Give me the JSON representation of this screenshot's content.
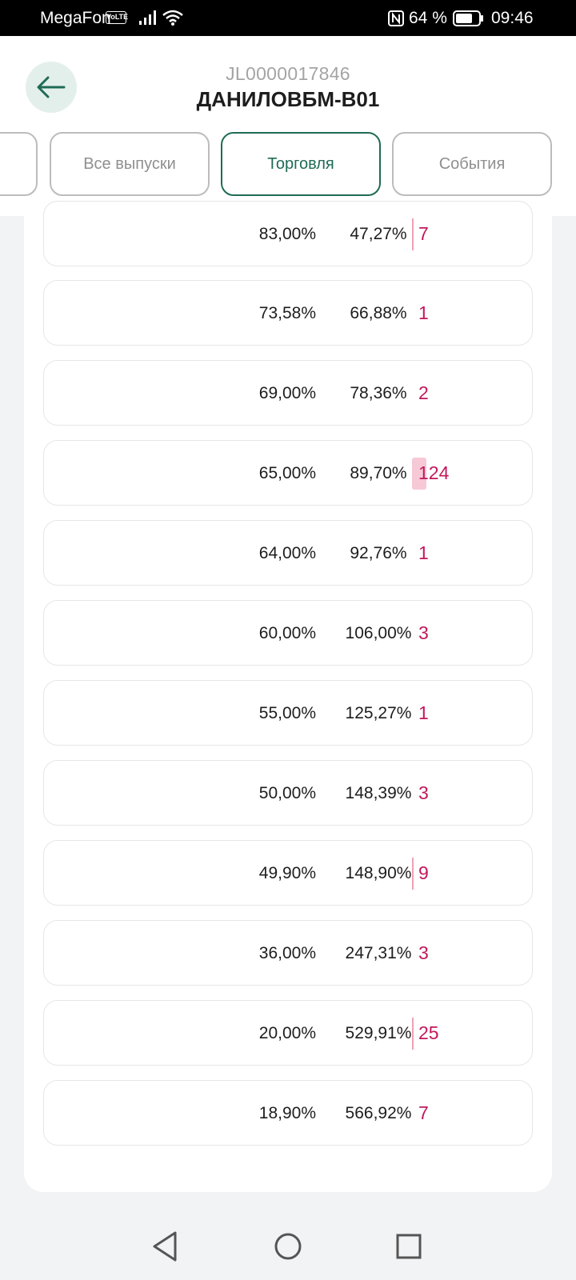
{
  "status_bar": {
    "carrier": "MegaFon",
    "volte": "VoLTE",
    "battery_percent": "64 %",
    "time": "09:46"
  },
  "header": {
    "subtitle": "JL0000017846",
    "title": "ДАНИЛОВБМ-В01"
  },
  "tabs": [
    {
      "label": "",
      "active": false
    },
    {
      "label": "Все выпуски",
      "active": false
    },
    {
      "label": "Торговля",
      "active": true
    },
    {
      "label": "События",
      "active": false
    }
  ],
  "rows": [
    {
      "price": "83,00%",
      "yield": "47,27%",
      "qty": "7"
    },
    {
      "price": "73,58%",
      "yield": "66,88%",
      "qty": "1"
    },
    {
      "price": "69,00%",
      "yield": "78,36%",
      "qty": "2"
    },
    {
      "price": "65,00%",
      "yield": "89,70%",
      "qty": "124"
    },
    {
      "price": "64,00%",
      "yield": "92,76%",
      "qty": "1"
    },
    {
      "price": "60,00%",
      "yield": "106,00%",
      "qty": "3"
    },
    {
      "price": "55,00%",
      "yield": "125,27%",
      "qty": "1"
    },
    {
      "price": "50,00%",
      "yield": "148,39%",
      "qty": "3"
    },
    {
      "price": "49,90%",
      "yield": "148,90%",
      "qty": "9"
    },
    {
      "price": "36,00%",
      "yield": "247,31%",
      "qty": "3"
    },
    {
      "price": "20,00%",
      "yield": "529,91%",
      "qty": "25"
    },
    {
      "price": "18,90%",
      "yield": "566,92%",
      "qty": "7"
    }
  ],
  "colors": {
    "accent": "#1f6b55",
    "quantity": "#c2185b",
    "quantity_bar": "#f0a0b6"
  }
}
